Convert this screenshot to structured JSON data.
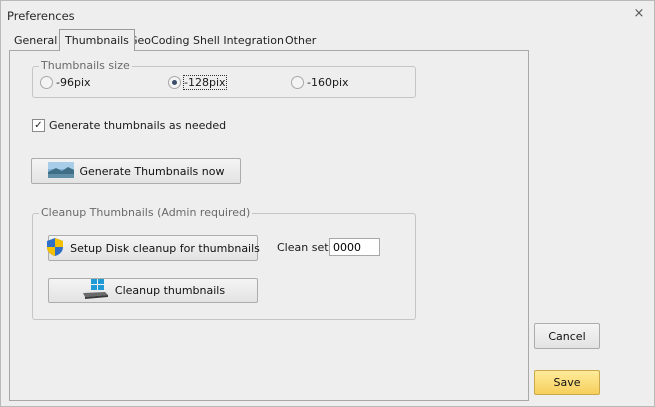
{
  "window": {
    "title": "Preferences",
    "close_glyph": "×"
  },
  "tabs": [
    {
      "label": "General",
      "active": false
    },
    {
      "label": "Thumbnails",
      "active": true
    },
    {
      "label": "GeoCoding",
      "active": false
    },
    {
      "label": "Shell Integration",
      "active": false
    },
    {
      "label": "Other",
      "active": false
    }
  ],
  "thumbnails_size": {
    "legend": "Thumbnails size",
    "options": [
      {
        "label": "-96pix",
        "selected": false
      },
      {
        "label": "-128pix",
        "selected": true
      },
      {
        "label": "-160pix",
        "selected": false
      }
    ]
  },
  "generate_as_needed": {
    "label": "Generate thumbnails as needed",
    "checked": true,
    "glyph": "✓"
  },
  "generate_now_button": {
    "label": "Generate Thumbnails now",
    "icon": "landscape-image-icon"
  },
  "cleanup_group": {
    "legend": "Cleanup Thumbnails (Admin required)",
    "setup_button": {
      "label": "Setup Disk cleanup for thumbnails",
      "icon": "shield-icon"
    },
    "clean_set": {
      "label": "Clean set",
      "value": "0000"
    },
    "cleanup_button": {
      "label": "Cleanup thumbnails",
      "icon": "windows-drive-icon"
    }
  },
  "buttons": {
    "cancel": "Cancel",
    "save": "Save"
  },
  "colors": {
    "save_accent": "#f6cf5c",
    "window_bg": "#eeeeee"
  }
}
